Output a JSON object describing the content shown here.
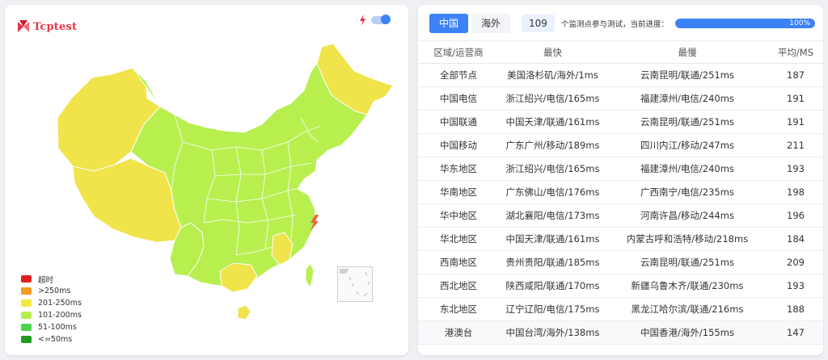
{
  "brand": {
    "name": "Tcptest"
  },
  "map": {
    "icon": "lightning-icon",
    "toggle_on": true
  },
  "legend": [
    {
      "label": "超时",
      "color": "#e02020"
    },
    {
      "label": ">250ms",
      "color": "#f59a23"
    },
    {
      "label": "201-250ms",
      "color": "#f5e642"
    },
    {
      "label": "101-200ms",
      "color": "#b7ef4f"
    },
    {
      "label": "51-100ms",
      "color": "#4cd44c"
    },
    {
      "label": "<=50ms",
      "color": "#1e9c1e"
    }
  ],
  "tabs": [
    {
      "label": "中国",
      "active": true
    },
    {
      "label": "海外",
      "active": false
    }
  ],
  "probe": {
    "count": "109",
    "label": "个监测点参与测试，当前进度：",
    "progress_label": "100%",
    "progress": 1.0
  },
  "table": {
    "headers": [
      "区域/运营商",
      "最快",
      "最慢",
      "平均/MS"
    ],
    "rows": [
      [
        "全部节点",
        "美国洛杉矶/海外/1ms",
        "云南昆明/联通/251ms",
        "187"
      ],
      [
        "中国电信",
        "浙江绍兴/电信/165ms",
        "福建漳州/电信/240ms",
        "191"
      ],
      [
        "中国联通",
        "中国天津/联通/161ms",
        "云南昆明/联通/251ms",
        "191"
      ],
      [
        "中国移动",
        "广东广州/移动/189ms",
        "四川内江/移动/247ms",
        "211"
      ],
      [
        "华东地区",
        "浙江绍兴/电信/165ms",
        "福建漳州/电信/240ms",
        "193"
      ],
      [
        "华南地区",
        "广东佛山/电信/176ms",
        "广西南宁/电信/235ms",
        "198"
      ],
      [
        "华中地区",
        "湖北襄阳/电信/173ms",
        "河南许昌/移动/244ms",
        "196"
      ],
      [
        "华北地区",
        "中国天津/联通/161ms",
        "内蒙古呼和浩特/移动/218ms",
        "184"
      ],
      [
        "西南地区",
        "贵州贵阳/联通/185ms",
        "云南昆明/联通/251ms",
        "209"
      ],
      [
        "西北地区",
        "陕西咸阳/联通/170ms",
        "新疆乌鲁木齐/联通/230ms",
        "193"
      ],
      [
        "东北地区",
        "辽宁辽阳/电信/175ms",
        "黑龙江哈尔滨/联通/216ms",
        "188"
      ],
      [
        "港澳台",
        "中国台湾/海外/138ms",
        "中国香港/海外/155ms",
        "147"
      ]
    ]
  }
}
